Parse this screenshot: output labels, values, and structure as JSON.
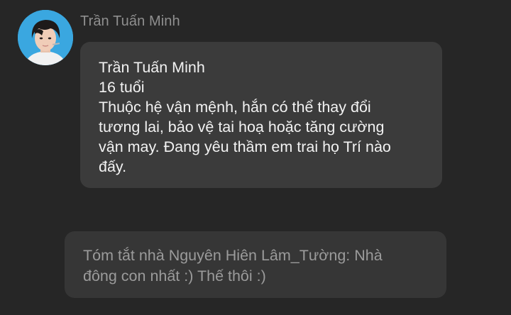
{
  "sender": {
    "name": "Trần Tuấn Minh"
  },
  "message_main": {
    "lines": [
      "Trần Tuấn Minh",
      "16 tuổi",
      "Thuộc hệ vận mệnh, hắn có thể thay đổi",
      "tương lai, bảo vệ tai hoạ hoặc tăng cường",
      "vận may. Đang yêu thầm em trai họ Trí nào",
      "đấy."
    ]
  },
  "message_second": {
    "lines": [
      "Tóm tắt nhà Nguyên Hiên Lâm_Tường: Nhà",
      "đông con nhất :) Thế thôi :)"
    ]
  },
  "colors": {
    "background": "#262626",
    "bubble": "#3b3b3b",
    "bubble_faded": "#363636",
    "text_primary": "#f2f2f2",
    "text_secondary": "#9b9b9b",
    "avatar_ring": "#3aa7e0"
  }
}
